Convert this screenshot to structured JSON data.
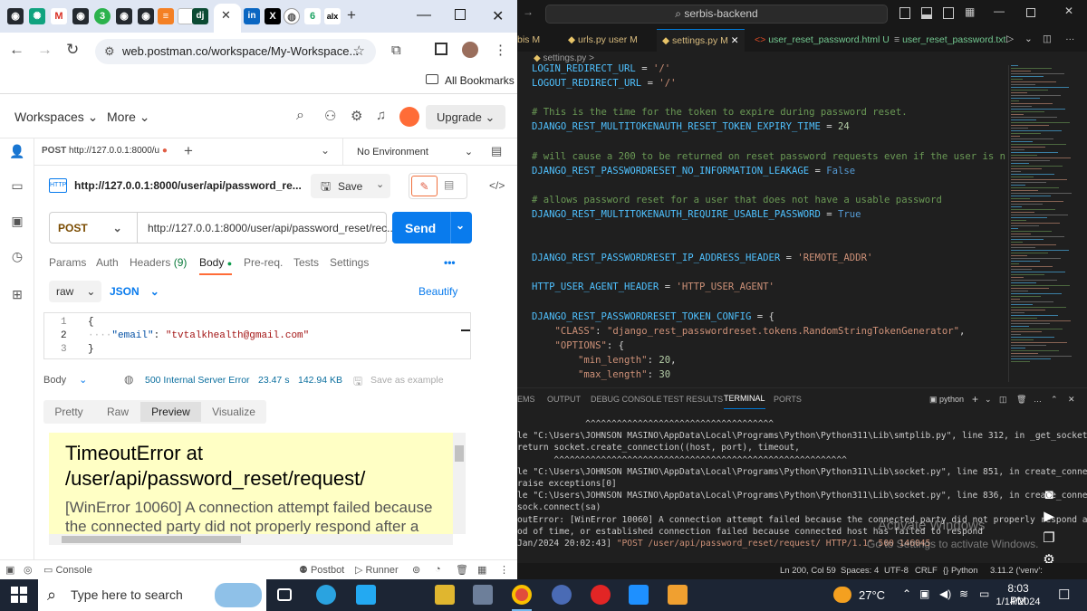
{
  "browser": {
    "active_tab_favicon": "dj",
    "url": "web.postman.co/workspace/My-Workspace...",
    "bookmarks_label": "All Bookmarks"
  },
  "postman": {
    "header": {
      "workspaces": "Workspaces",
      "more": "More",
      "upgrade": "Upgrade"
    },
    "request_tab": {
      "method": "POST",
      "url": "http://127.0.0.1:8000/u",
      "environment": "No Environment"
    },
    "request_title": "http://127.0.0.1:8000/user/api/password_re...",
    "save_label": "Save",
    "method": "POST",
    "request_url": "http://127.0.0.1:8000/user/api/password_reset/rec...",
    "send_label": "Send",
    "subtabs": {
      "params": "Params",
      "auth": "Auth",
      "headers": "Headers",
      "headers_count": "(9)",
      "body": "Body",
      "prereq": "Pre-req.",
      "tests": "Tests",
      "settings": "Settings"
    },
    "body_mode": "raw",
    "body_lang": "JSON",
    "beautify": "Beautify",
    "editor_lines": [
      {
        "n": "1",
        "text": "{"
      },
      {
        "n": "2",
        "key": "\"email\"",
        "sep": ": ",
        "value": "\"tvtalkhealth@gmail.com\""
      },
      {
        "n": "3",
        "text": "}"
      }
    ],
    "response": {
      "body_label": "Body",
      "status": "500 Internal Server Error",
      "time": "23.47 s",
      "size": "142.94 KB",
      "save_example": "Save as example",
      "tabs": [
        "Pretty",
        "Raw",
        "Preview",
        "Visualize"
      ],
      "error_title": "TimeoutError at /user/api/password_reset/request/",
      "error_message": "[WinError 10060] A connection attempt failed because the connected party did not properly respond after a"
    },
    "footer": {
      "console": "Console",
      "postbot": "Postbot",
      "runner": "Runner"
    }
  },
  "vscode": {
    "search": "serbis-backend",
    "tabs": [
      "bis M",
      "urls.py user M",
      "settings.py M",
      "user_reset_password.html U",
      "user_reset_password.txt"
    ],
    "breadcrumb": "settings.py >",
    "code": [
      [
        {
          "t": "LOGIN_REDIRECT_URL",
          "c": "c-var"
        },
        {
          "t": " = ",
          "c": "c-op"
        },
        {
          "t": "'/'",
          "c": "c-str"
        }
      ],
      [
        {
          "t": "LOGOUT_REDIRECT_URL",
          "c": "c-var"
        },
        {
          "t": " = ",
          "c": "c-op"
        },
        {
          "t": "'/'",
          "c": "c-str"
        }
      ],
      [],
      [
        {
          "t": "# This is the time for the token to expire during password reset.",
          "c": "c-com"
        }
      ],
      [
        {
          "t": "DJANGO_REST_MULTITOKENAUTH_RESET_TOKEN_EXPIRY_TIME",
          "c": "c-var"
        },
        {
          "t": " = ",
          "c": "c-op"
        },
        {
          "t": "24",
          "c": "c-num"
        }
      ],
      [],
      [
        {
          "t": "# will cause a 200 to be returned on reset password requests even if the user is n",
          "c": "c-com"
        }
      ],
      [
        {
          "t": "DJANGO_REST_PASSWORDRESET_NO_INFORMATION_LEAKAGE",
          "c": "c-var"
        },
        {
          "t": " = ",
          "c": "c-op"
        },
        {
          "t": "False",
          "c": "c-kw"
        }
      ],
      [],
      [
        {
          "t": "# allows password reset for a user that does not have a usable password",
          "c": "c-com"
        }
      ],
      [
        {
          "t": "DJANGO_REST_MULTITOKENAUTH_REQUIRE_USABLE_PASSWORD",
          "c": "c-var"
        },
        {
          "t": " = ",
          "c": "c-op"
        },
        {
          "t": "True",
          "c": "c-kw"
        }
      ],
      [],
      [],
      [
        {
          "t": "DJANGO_REST_PASSWORDRESET_IP_ADDRESS_HEADER",
          "c": "c-var"
        },
        {
          "t": " = ",
          "c": "c-op"
        },
        {
          "t": "'REMOTE_ADDR'",
          "c": "c-str"
        }
      ],
      [],
      [
        {
          "t": "HTTP_USER_AGENT_HEADER",
          "c": "c-var"
        },
        {
          "t": " = ",
          "c": "c-op"
        },
        {
          "t": "'HTTP_USER_AGENT'",
          "c": "c-str"
        }
      ],
      [],
      [
        {
          "t": "DJANGO_REST_PASSWORDRESET_TOKEN_CONFIG",
          "c": "c-var"
        },
        {
          "t": " = {",
          "c": "c-op"
        }
      ],
      [
        {
          "t": "    \"CLASS\"",
          "c": "c-key"
        },
        {
          "t": ": ",
          "c": "c-op"
        },
        {
          "t": "\"django_rest_passwordreset.tokens.RandomStringTokenGenerator\"",
          "c": "c-str"
        },
        {
          "t": ",",
          "c": "c-op"
        }
      ],
      [
        {
          "t": "    \"OPTIONS\"",
          "c": "c-key"
        },
        {
          "t": ": {",
          "c": "c-op"
        }
      ],
      [
        {
          "t": "        \"min_length\"",
          "c": "c-key"
        },
        {
          "t": ": ",
          "c": "c-op"
        },
        {
          "t": "20",
          "c": "c-num"
        },
        {
          "t": ",",
          "c": "c-op"
        }
      ],
      [
        {
          "t": "        \"max_length\"",
          "c": "c-key"
        },
        {
          "t": ": ",
          "c": "c-op"
        },
        {
          "t": "30",
          "c": "c-num"
        }
      ]
    ],
    "panel_tabs": [
      "EMS",
      "OUTPUT",
      "DEBUG CONSOLE",
      "TEST RESULTS",
      "TERMINAL",
      "PORTS"
    ],
    "terminal_shell": "python",
    "terminal": [
      "             ^^^^^^^^^^^^^^^^^^^^^^^^^^^^^^^^^^^^",
      "le \"C:\\Users\\JOHNSON MASINO\\AppData\\Local\\Programs\\Python\\Python311\\Lib\\smtplib.py\", line 312, in _get_socket",
      "return socket.create_connection((host, port), timeout,",
      "       ^^^^^^^^^^^^^^^^^^^^^^^^^^^^^^^^^^^^^^^^^^^^^^^^^^^^^^^^",
      "le \"C:\\Users\\JOHNSON MASINO\\AppData\\Local\\Programs\\Python\\Python311\\Lib\\socket.py\", line 851, in create_connecti",
      "raise exceptions[0]",
      "le \"C:\\Users\\JOHNSON MASINO\\AppData\\Local\\Programs\\Python\\Python311\\Lib\\socket.py\", line 836, in create_connecti",
      "sock.connect(sa)",
      "outError: [WinError 10060] A connection attempt failed because the connected party did not properly respond a",
      "od of time, or established connection failed because connected host has failed to respond",
      "Jan/2024 20:02:43] \"POST /user/api/password_reset/request/ HTTP/1.1\" 500 146045"
    ],
    "activate_title": "Activate Windows",
    "activate_sub": "Go to Settings to activate Windows.",
    "status": {
      "pos": "Ln 200, Col 59",
      "spaces": "Spaces: 4",
      "enc": "UTF-8",
      "eol": "CRLF",
      "lang": "Python",
      "ver": "3.11.2 ('venv':"
    }
  },
  "taskbar": {
    "search": "Type here to search",
    "temp": "27°C",
    "time": "8:03 PM",
    "date": "1/14/2024"
  }
}
